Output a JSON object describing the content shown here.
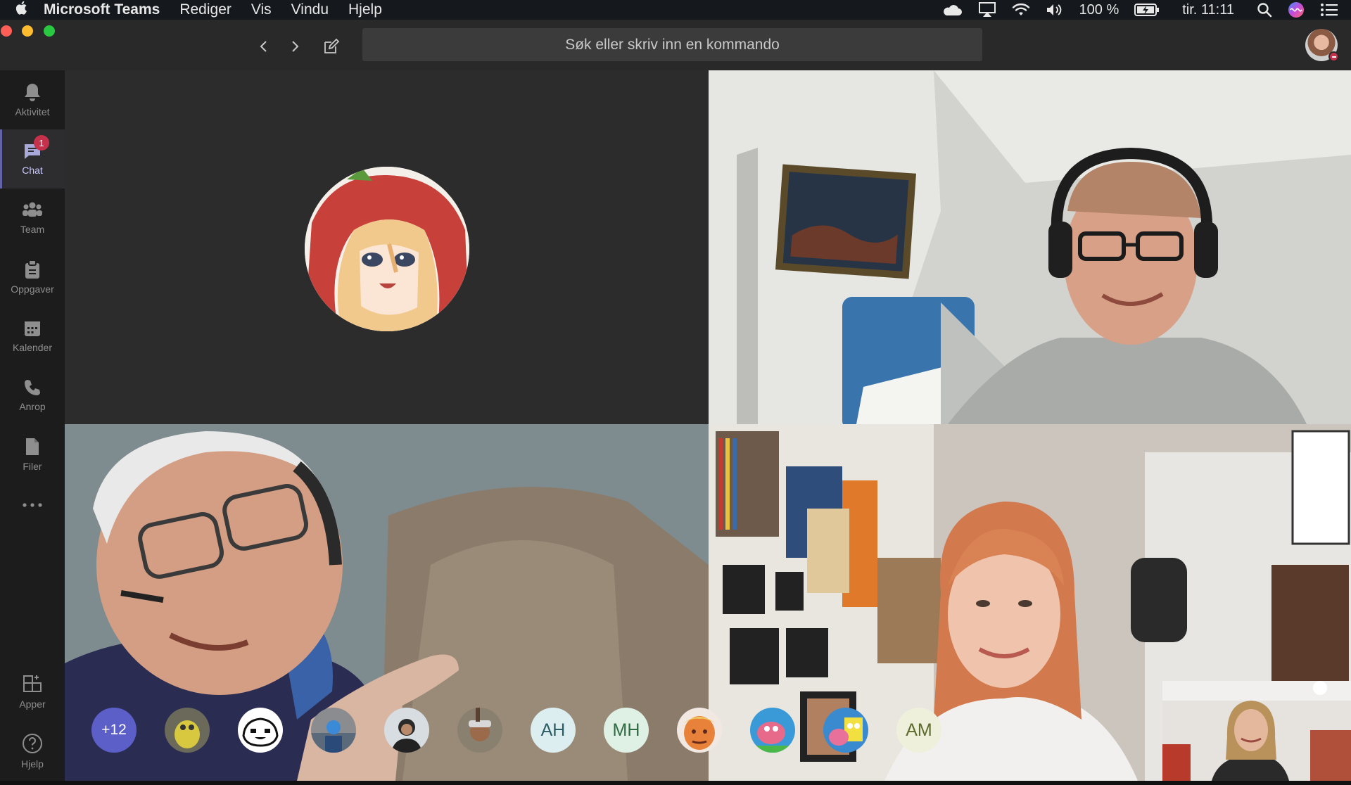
{
  "menubar": {
    "app_name": "Microsoft Teams",
    "menus": [
      "Rediger",
      "Vis",
      "Vindu",
      "Hjelp"
    ],
    "battery": "100 %",
    "clock": "tir. 11:11",
    "status_icons": [
      "cloud-icon",
      "airplay-icon",
      "wifi-icon",
      "volume-icon",
      "battery-icon",
      "spotlight-icon",
      "siri-icon",
      "notification-center-icon"
    ]
  },
  "titlebar": {
    "search_placeholder": "Søk eller skriv inn en kommando"
  },
  "rail": {
    "items": [
      {
        "label": "Aktivitet",
        "icon": "bell-icon"
      },
      {
        "label": "Chat",
        "icon": "chat-icon",
        "badge": "1",
        "active": true
      },
      {
        "label": "Team",
        "icon": "team-icon"
      },
      {
        "label": "Oppgaver",
        "icon": "assignments-icon"
      },
      {
        "label": "Kalender",
        "icon": "calendar-icon"
      },
      {
        "label": "Anrop",
        "icon": "phone-icon"
      },
      {
        "label": "Filer",
        "icon": "file-icon"
      }
    ],
    "more_icon": "more-icon",
    "bottom_items": [
      {
        "label": "Apper",
        "icon": "apps-icon"
      },
      {
        "label": "Hjelp",
        "icon": "help-icon"
      }
    ]
  },
  "attendees": {
    "overflow": "+12",
    "avatars": [
      {
        "type": "photo",
        "icon": "avatar-creature"
      },
      {
        "type": "photo",
        "icon": "avatar-cartoon"
      },
      {
        "type": "photo",
        "icon": "avatar-cyclist"
      },
      {
        "type": "photo",
        "icon": "avatar-person"
      },
      {
        "type": "photo",
        "icon": "avatar-person-hat"
      },
      {
        "type": "initials",
        "text": "AH"
      },
      {
        "type": "initials",
        "text": "MH"
      },
      {
        "type": "photo",
        "icon": "avatar-orange-face"
      },
      {
        "type": "photo",
        "icon": "avatar-cartoon-pink"
      },
      {
        "type": "photo",
        "icon": "avatar-cartoon-sponge"
      },
      {
        "type": "initials",
        "text": "AM"
      }
    ]
  },
  "colors": {
    "accent": "#6264a7",
    "badge": "#c4314b",
    "overflow_avatar": "#5b5fc7"
  }
}
